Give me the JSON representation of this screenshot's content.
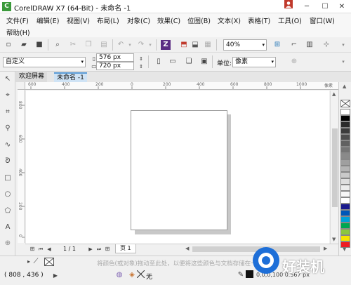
{
  "window": {
    "title": "CorelDRAW X7 (64-Bit) - 未命名 -1",
    "logo": "C"
  },
  "menu": [
    {
      "label": "文件(F)"
    },
    {
      "label": "编辑(E)"
    },
    {
      "label": "视图(V)"
    },
    {
      "label": "布局(L)"
    },
    {
      "label": "对象(C)"
    },
    {
      "label": "效果(C)"
    },
    {
      "label": "位图(B)"
    },
    {
      "label": "文本(X)"
    },
    {
      "label": "表格(T)"
    },
    {
      "label": "工具(O)"
    },
    {
      "label": "窗口(W)"
    },
    {
      "label": "帮助(H)"
    }
  ],
  "toolbar": {
    "zoom": "40%"
  },
  "propertybar": {
    "preset": "自定义",
    "width": "576 px",
    "height": "720 px",
    "units_label": "单位:",
    "units_value": "像素"
  },
  "tabs": [
    {
      "label": "欢迎屏幕"
    },
    {
      "label": "未命名 -1"
    }
  ],
  "ruler_h": [
    "600",
    "400",
    "200",
    "0",
    "200",
    "400",
    "600",
    "800",
    "1000"
  ],
  "ruler_v": [
    "800",
    "600",
    "400",
    "200",
    "0"
  ],
  "ruler_unit": "像素",
  "pagenav": {
    "counter": "1 / 1",
    "page_tab": "页 1"
  },
  "statusbar": {
    "coords": "( 808 , 436 )",
    "fill_label": "无",
    "hint": "将颜色(或对象)拖动至此处，以便将这些颜色与文档存储在一起",
    "info": "0,0,0,100  0.567 px"
  },
  "palette": [
    "#ffffff",
    "#000000",
    "#2b2b2b",
    "#3c3c3c",
    "#4e4e4e",
    "#616161",
    "#757575",
    "#8a8a8a",
    "#9f9f9f",
    "#b4b4b4",
    "#c9c9c9",
    "#dedede",
    "#ececec",
    "#f7f7f7",
    "#ffffff",
    "#1a1a8c",
    "#0057b8",
    "#00a0d8",
    "#00a651",
    "#8dc63f",
    "#f7e400",
    "#ed1c24"
  ],
  "watermark": {
    "text": "好装机"
  }
}
